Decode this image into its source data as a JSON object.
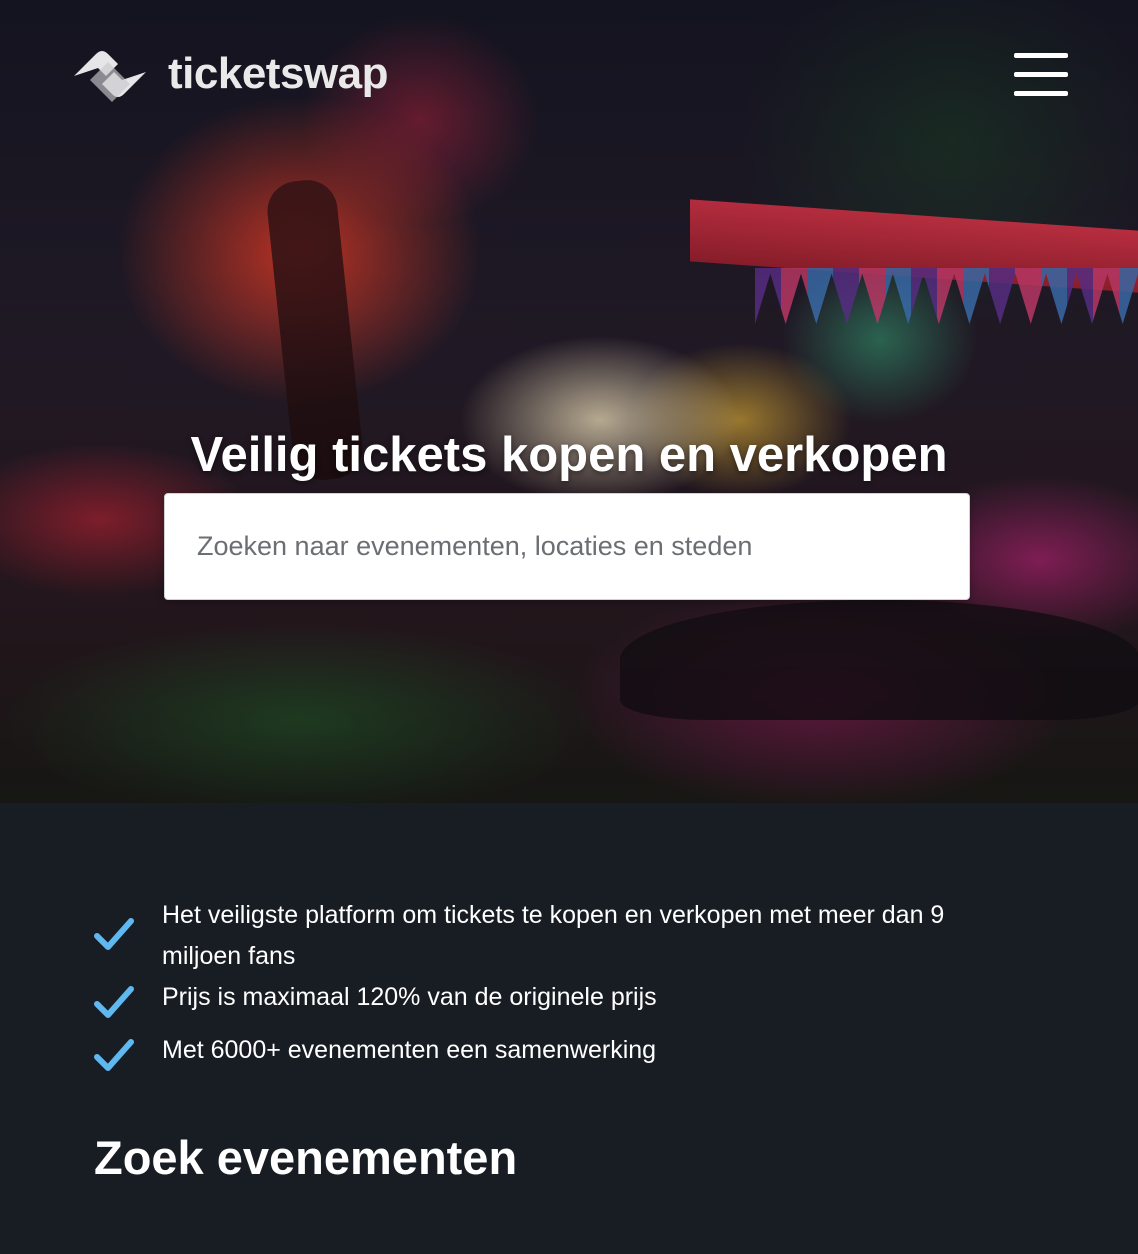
{
  "brand": {
    "name": "ticketswap",
    "logo_icon": "ticketswap-logo-icon"
  },
  "header": {
    "menu_icon": "hamburger-menu-icon"
  },
  "hero": {
    "title": "Veilig tickets kopen en verkopen",
    "search": {
      "value": "",
      "placeholder": "Zoeken naar evenementen, locaties en steden"
    }
  },
  "features": {
    "icon": "checkmark-icon",
    "accent_color": "#5fb8ef",
    "items": [
      {
        "text": "Het veiligste platform om tickets te kopen en verkopen met meer dan 9 miljoen fans"
      },
      {
        "text": "Prijs is maximaal 120% van de originele prijs"
      },
      {
        "text": "Met 6000+ evenementen een samenwerking"
      }
    ]
  },
  "section": {
    "title": "Zoek evenementen"
  },
  "colors": {
    "page_background": "#181d24",
    "text": "#ffffff",
    "search_background": "#ffffff"
  }
}
